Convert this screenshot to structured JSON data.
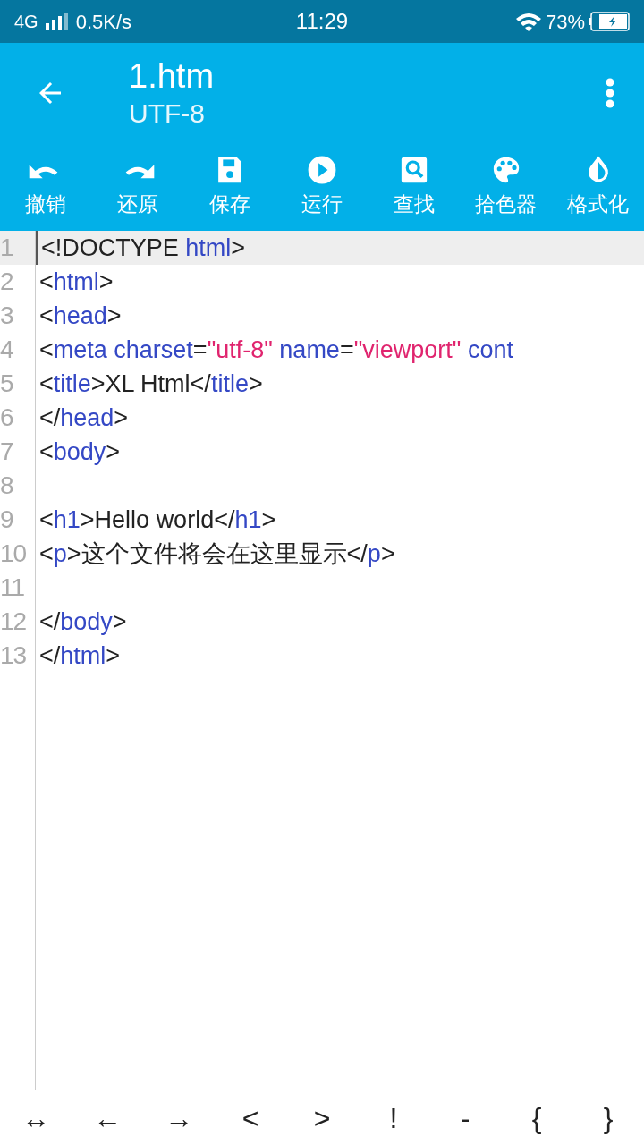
{
  "status_bar": {
    "network": "4G",
    "speed": "0.5K/s",
    "time": "11:29",
    "battery": "73%"
  },
  "app_bar": {
    "title": "1.htm",
    "subtitle": "UTF-8"
  },
  "toolbar": [
    {
      "kind": "undo",
      "label": "撤销"
    },
    {
      "kind": "redo",
      "label": "还原"
    },
    {
      "kind": "save",
      "label": "保存"
    },
    {
      "kind": "run",
      "label": "运行"
    },
    {
      "kind": "find",
      "label": "查找"
    },
    {
      "kind": "palette",
      "label": "拾色器"
    },
    {
      "kind": "format",
      "label": "格式化"
    }
  ],
  "editor": {
    "lines": [
      {
        "number": "1",
        "current": true,
        "tokens": [
          {
            "kind": "text",
            "text": "<!DOCTYPE "
          },
          {
            "kind": "tag",
            "text": "html"
          },
          {
            "kind": "text",
            "text": ">"
          }
        ]
      },
      {
        "number": "2",
        "current": false,
        "tokens": [
          {
            "kind": "text",
            "text": "<"
          },
          {
            "kind": "tag",
            "text": "html"
          },
          {
            "kind": "text",
            "text": ">"
          }
        ]
      },
      {
        "number": "3",
        "current": false,
        "tokens": [
          {
            "kind": "text",
            "text": "<"
          },
          {
            "kind": "tag",
            "text": "head"
          },
          {
            "kind": "text",
            "text": ">"
          }
        ]
      },
      {
        "number": "4",
        "current": false,
        "tokens": [
          {
            "kind": "text",
            "text": "<"
          },
          {
            "kind": "tag",
            "text": "meta charset"
          },
          {
            "kind": "text",
            "text": "="
          },
          {
            "kind": "string",
            "text": "\"utf-8\""
          },
          {
            "kind": "tag",
            "text": " name"
          },
          {
            "kind": "text",
            "text": "="
          },
          {
            "kind": "string",
            "text": "\"viewport\""
          },
          {
            "kind": "tag",
            "text": " cont"
          }
        ]
      },
      {
        "number": "5",
        "current": false,
        "tokens": [
          {
            "kind": "text",
            "text": "<"
          },
          {
            "kind": "tag",
            "text": "title"
          },
          {
            "kind": "text",
            "text": ">XL Html</"
          },
          {
            "kind": "tag",
            "text": "title"
          },
          {
            "kind": "text",
            "text": ">"
          }
        ]
      },
      {
        "number": "6",
        "current": false,
        "tokens": [
          {
            "kind": "text",
            "text": "</"
          },
          {
            "kind": "tag",
            "text": "head"
          },
          {
            "kind": "text",
            "text": ">"
          }
        ]
      },
      {
        "number": "7",
        "current": false,
        "tokens": [
          {
            "kind": "text",
            "text": "<"
          },
          {
            "kind": "tag",
            "text": "body"
          },
          {
            "kind": "text",
            "text": ">"
          }
        ]
      },
      {
        "number": "8",
        "current": false
      },
      {
        "number": "9",
        "current": false,
        "tokens": [
          {
            "kind": "text",
            "text": "<"
          },
          {
            "kind": "tag",
            "text": "h1"
          },
          {
            "kind": "text",
            "text": ">Hello world</"
          },
          {
            "kind": "tag",
            "text": "h1"
          },
          {
            "kind": "text",
            "text": ">"
          }
        ]
      },
      {
        "number": "10",
        "current": false,
        "tokens": [
          {
            "kind": "text",
            "text": "<"
          },
          {
            "kind": "tag",
            "text": "p"
          },
          {
            "kind": "text",
            "text": ">这个文件将会在这里显示</"
          },
          {
            "kind": "tag",
            "text": "p"
          },
          {
            "kind": "text",
            "text": ">"
          }
        ]
      },
      {
        "number": "11",
        "current": false
      },
      {
        "number": "12",
        "current": false,
        "tokens": [
          {
            "kind": "text",
            "text": "</"
          },
          {
            "kind": "tag",
            "text": "body"
          },
          {
            "kind": "text",
            "text": ">"
          }
        ]
      },
      {
        "number": "13",
        "current": false,
        "tokens": [
          {
            "kind": "text",
            "text": "</"
          },
          {
            "kind": "tag",
            "text": "html"
          },
          {
            "kind": "text",
            "text": ">"
          }
        ]
      }
    ]
  },
  "symbol_keys": [
    "↔",
    "←",
    "→",
    "<",
    ">",
    "!",
    "-",
    "{",
    "}"
  ]
}
